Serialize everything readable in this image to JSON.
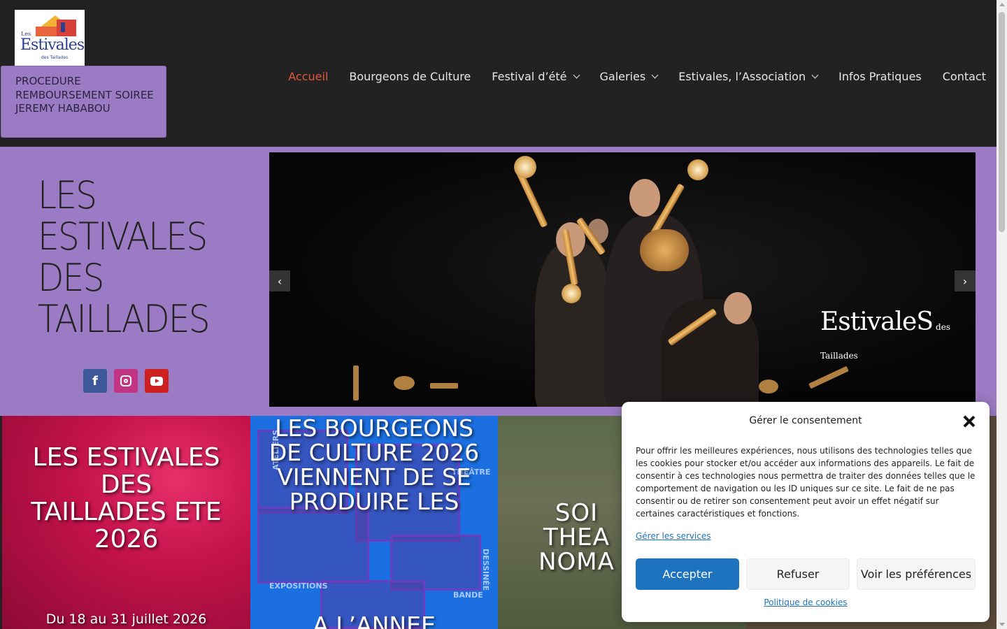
{
  "header": {
    "logo": {
      "line1": "Les",
      "line2": "Estivales",
      "line3": "des Taillades"
    },
    "procedure_button": "PROCEDURE REMBOURSEMENT SOIREE JEREMY HABABOU",
    "nav": [
      {
        "label": "Accueil",
        "active": true,
        "dropdown": false
      },
      {
        "label": "Bourgeons de Culture",
        "active": false,
        "dropdown": false
      },
      {
        "label": "Festival d’été",
        "active": false,
        "dropdown": true
      },
      {
        "label": "Galeries",
        "active": false,
        "dropdown": true
      },
      {
        "label": "Estivales, l’Association",
        "active": false,
        "dropdown": true
      },
      {
        "label": "Infos Pratiques",
        "active": false,
        "dropdown": false
      },
      {
        "label": "Contact",
        "active": false,
        "dropdown": false
      }
    ]
  },
  "hero": {
    "title_lines": [
      "LES",
      "ESTIVALES",
      "DES",
      "TAILLADES"
    ],
    "social": [
      {
        "icon": "facebook-icon",
        "glyph": "f"
      },
      {
        "icon": "instagram-icon"
      },
      {
        "icon": "youtube-icon"
      }
    ],
    "slider": {
      "prev_glyph": "‹",
      "next_glyph": "›",
      "logo_text": "EstivaleS",
      "logo_small": "des Taillades"
    }
  },
  "tiles": [
    {
      "title": "LES ESTIVALES DES TAILLADES ETE 2026",
      "subtitle": "Du 18 au 31 juillet 2026"
    },
    {
      "title": "LES BOURGEONS DE CULTURE 2026 VIENNENT DE SE PRODUIRE LES",
      "bottom": "A L’ANNEE",
      "labels": [
        "ATELIERS",
        "THÉÂTRE",
        "EXPOSITIONS",
        "DESSINÉE",
        "BANDE"
      ]
    },
    {
      "title": "SOI THEA NOMA"
    },
    {
      "title": ""
    }
  ],
  "cookie": {
    "title": "Gérer le consentement",
    "body": "Pour offrir les meilleures expériences, nous utilisons des technologies telles que les cookies pour stocker et/ou accéder aux informations des appareils. Le fait de consentir à ces technologies nous permettra de traiter des données telles que le comportement de navigation ou les ID uniques sur ce site. Le fait de ne pas consentir ou de retirer son consentement peut avoir un effet négatif sur certaines caractéristiques et fonctions.",
    "manage_link": "Gérer les services",
    "accept": "Accepter",
    "refuse": "Refuser",
    "prefs": "Voir les préférences",
    "policy_link": "Politique de cookies"
  },
  "colors": {
    "header_bg": "#222222",
    "accent_purple": "#9b7bc3",
    "nav_active": "#e2583e",
    "accept_blue": "#1e73be"
  }
}
